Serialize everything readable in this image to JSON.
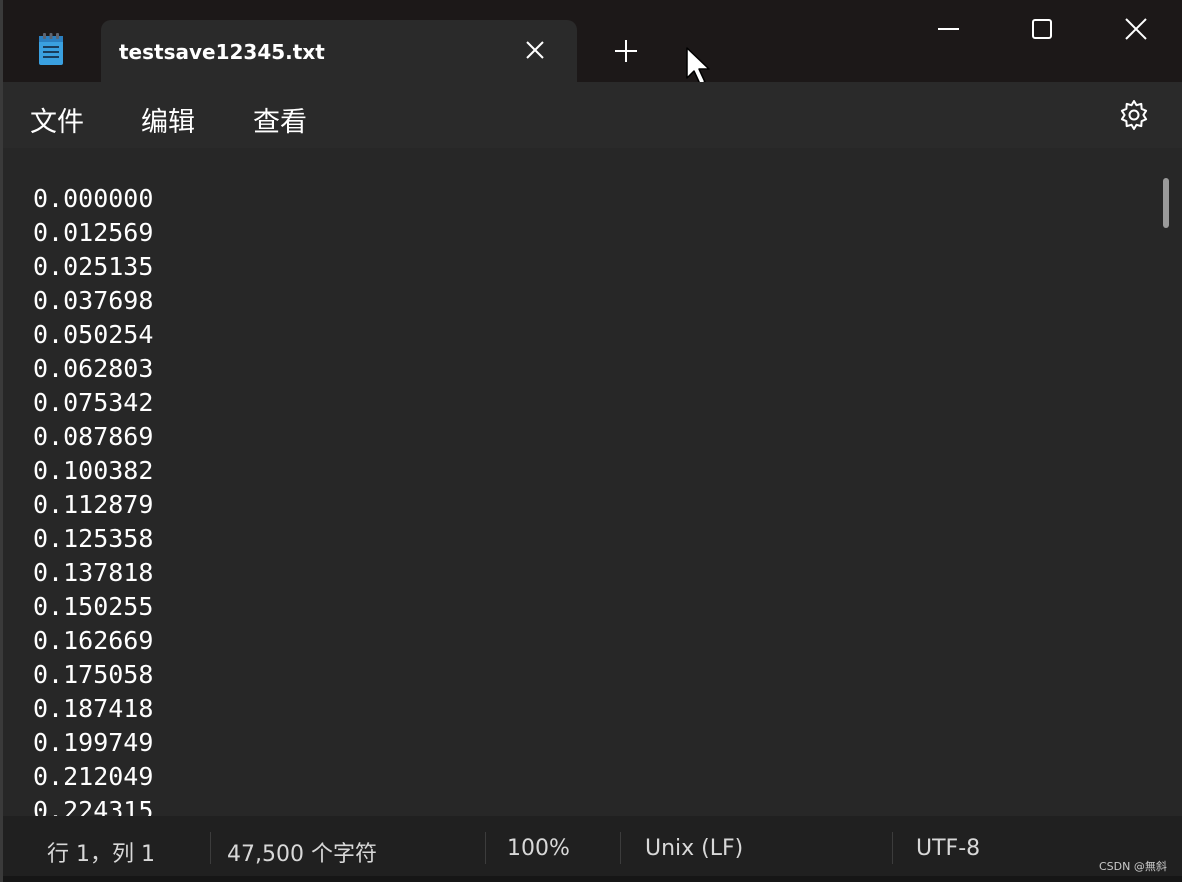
{
  "window": {
    "tab_title": "testsave12345.txt",
    "icons": {
      "app": "notepad-icon",
      "tab_close": "close-icon",
      "new_tab": "plus-icon",
      "minimize": "minimize-icon",
      "maximize": "maximize-icon",
      "close": "close-icon",
      "settings": "gear-icon"
    }
  },
  "menu": {
    "file": "文件",
    "edit": "编辑",
    "view": "查看"
  },
  "editor": {
    "lines": [
      "0.000000",
      "0.012569",
      "0.025135",
      "0.037698",
      "0.050254",
      "0.062803",
      "0.075342",
      "0.087869",
      "0.100382",
      "0.112879",
      "0.125358",
      "0.137818",
      "0.150255",
      "0.162669",
      "0.175058",
      "0.187418",
      "0.199749",
      "0.212049",
      "0.224315"
    ]
  },
  "status": {
    "position": "行 1，列 1",
    "char_count": "47,500 个字符",
    "zoom": "100%",
    "line_ending": "Unix (LF)",
    "encoding": "UTF-8",
    "watermark": "CSDN @無斜"
  },
  "colors": {
    "titlebar": "#1c1818",
    "tab": "#2a2a2a",
    "menubar": "#2a2a2a",
    "editor": "#272727",
    "statusbar": "#202020",
    "text": "#ffffff",
    "notepad_icon_blue": "#3aa0e0"
  }
}
